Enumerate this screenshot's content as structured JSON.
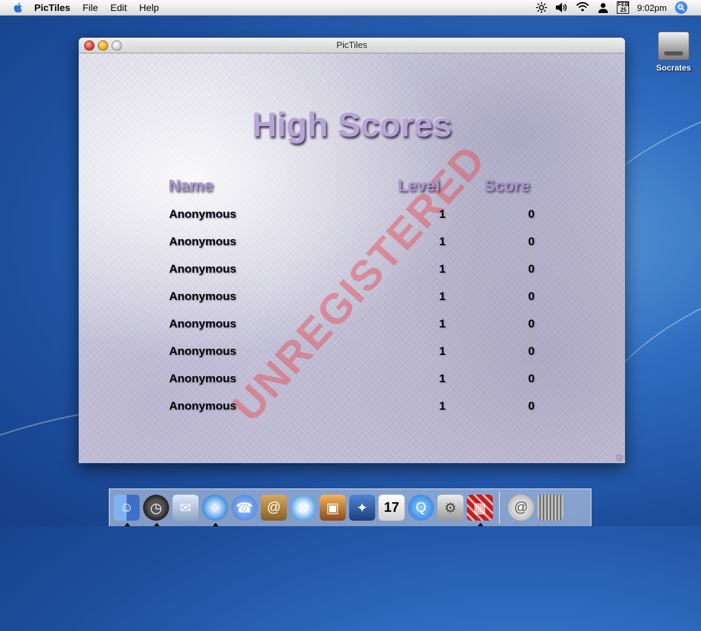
{
  "menubar": {
    "app_name": "PicTiles",
    "menus": [
      "File",
      "Edit",
      "Help"
    ],
    "clock": "9:02pm",
    "calendar_badge": "FEB 25"
  },
  "desktop": {
    "drive_label": "Socrates"
  },
  "window": {
    "title": "PicTiles",
    "heading": "High Scores",
    "columns": {
      "name": "Name",
      "level": "Level",
      "score": "Score"
    },
    "watermark": "UNREGISTERED",
    "rows": [
      {
        "name": "Anonymous",
        "level": "1",
        "score": "0"
      },
      {
        "name": "Anonymous",
        "level": "1",
        "score": "0"
      },
      {
        "name": "Anonymous",
        "level": "1",
        "score": "0"
      },
      {
        "name": "Anonymous",
        "level": "1",
        "score": "0"
      },
      {
        "name": "Anonymous",
        "level": "1",
        "score": "0"
      },
      {
        "name": "Anonymous",
        "level": "1",
        "score": "0"
      },
      {
        "name": "Anonymous",
        "level": "1",
        "score": "0"
      },
      {
        "name": "Anonymous",
        "level": "1",
        "score": "0"
      }
    ]
  },
  "dock": {
    "items": [
      {
        "name": "finder-icon",
        "color": "#5a8fd8",
        "running": true
      },
      {
        "name": "dashboard-icon",
        "color": "#333333",
        "running": true
      },
      {
        "name": "mail-icon",
        "color": "#8fa6c8",
        "running": false
      },
      {
        "name": "safari-icon",
        "color": "#3b8de0",
        "running": true
      },
      {
        "name": "ichat-icon",
        "color": "#3d78d8",
        "running": false
      },
      {
        "name": "address-book-icon",
        "color": "#b9873f",
        "running": false
      },
      {
        "name": "itunes-icon",
        "color": "#4a9ae0",
        "running": false
      },
      {
        "name": "iphoto-icon",
        "color": "#d88a36",
        "running": false
      },
      {
        "name": "imovie-icon",
        "color": "#2f5fa8",
        "running": false
      },
      {
        "name": "ical-icon",
        "color": "#e8e8e8",
        "running": false
      },
      {
        "name": "quicktime-icon",
        "color": "#2a7fe8",
        "running": false
      },
      {
        "name": "system-preferences-icon",
        "color": "#bdbdbd",
        "running": false
      },
      {
        "name": "pictiles-icon",
        "color": "#b02020",
        "running": true
      }
    ],
    "right_items": [
      {
        "name": "mail-address-icon",
        "color": "#c8c8c8"
      },
      {
        "name": "trash-icon",
        "color": "#8a8a8a"
      }
    ]
  }
}
